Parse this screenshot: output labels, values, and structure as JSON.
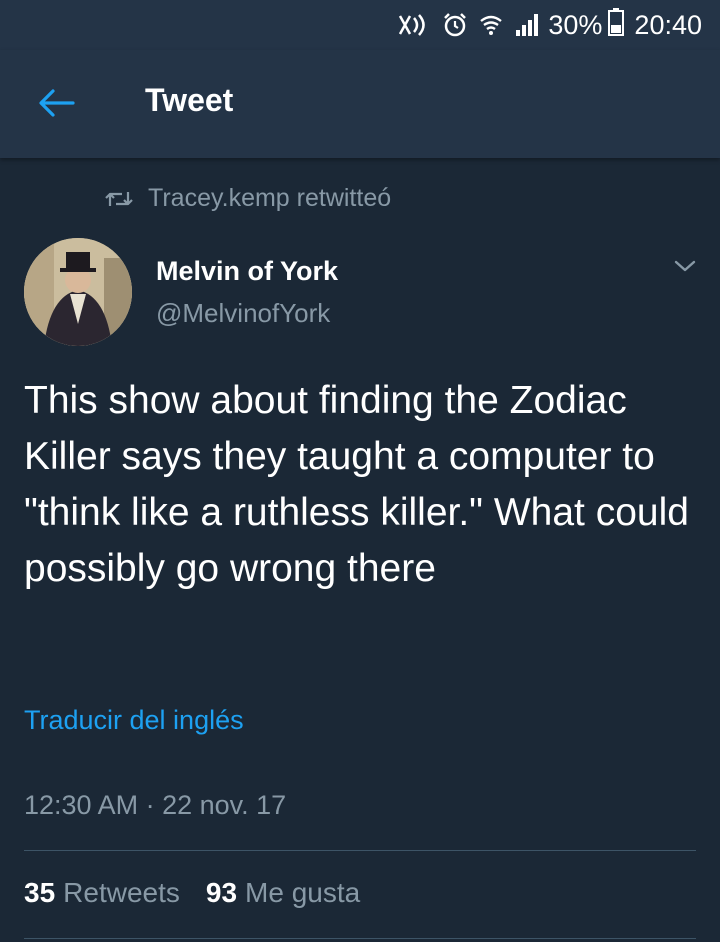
{
  "status_bar": {
    "battery": "30%",
    "time": "20:40",
    "icons": [
      "nfc-icon",
      "alarm-icon",
      "wifi-icon",
      "signal-icon",
      "battery-icon"
    ]
  },
  "header": {
    "back_icon": "arrow-left-icon",
    "title": "Tweet"
  },
  "retweet_context": {
    "icon": "retweet-icon",
    "text": "Tracey.kemp retwitteó"
  },
  "tweet": {
    "author_name": "Melvin of York",
    "author_handle": "@MelvinofYork",
    "text": "This show about finding the Zodiac Killer says they taught a computer to \"think like a ruthless killer.\" What could possibly go wrong there",
    "translate_label": "Traducir del inglés",
    "timestamp": "12:30 AM · 22 nov. 17"
  },
  "stats": {
    "retweets_count": "35",
    "retweets_label": "Retweets",
    "likes_count": "93",
    "likes_label": "Me gusta"
  },
  "colors": {
    "background": "#1b2836",
    "bar": "#243447",
    "accent": "#1da1f2",
    "secondary_text": "#8899a6"
  }
}
